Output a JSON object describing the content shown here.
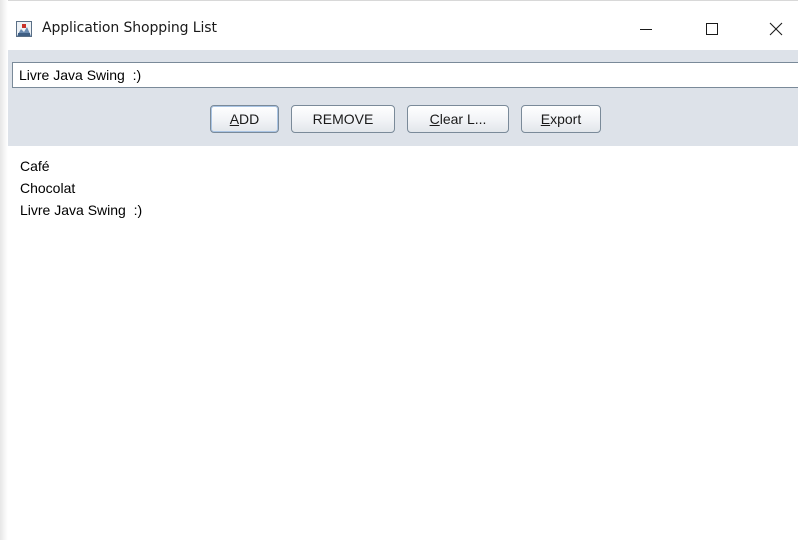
{
  "window": {
    "title": "Application Shopping List"
  },
  "controls": {
    "minimize_icon": "minimize-icon",
    "maximize_icon": "maximize-icon",
    "close_icon": "close-icon"
  },
  "input": {
    "value": "Livre Java Swing  :)"
  },
  "buttons": {
    "add": {
      "mnemonic": "A",
      "rest": "DD"
    },
    "remove": {
      "label": "REMOVE"
    },
    "clear": {
      "mnemonic": "C",
      "rest": "lear L..."
    },
    "export": {
      "mnemonic": "E",
      "rest": "xport"
    }
  },
  "list": {
    "items": [
      "Café",
      "Chocolat",
      "Livre Java Swing  :)"
    ]
  },
  "colors": {
    "panel_bg": "#dde2e9",
    "button_border": "#7a8a99",
    "app_icon_red": "#c8312a"
  }
}
